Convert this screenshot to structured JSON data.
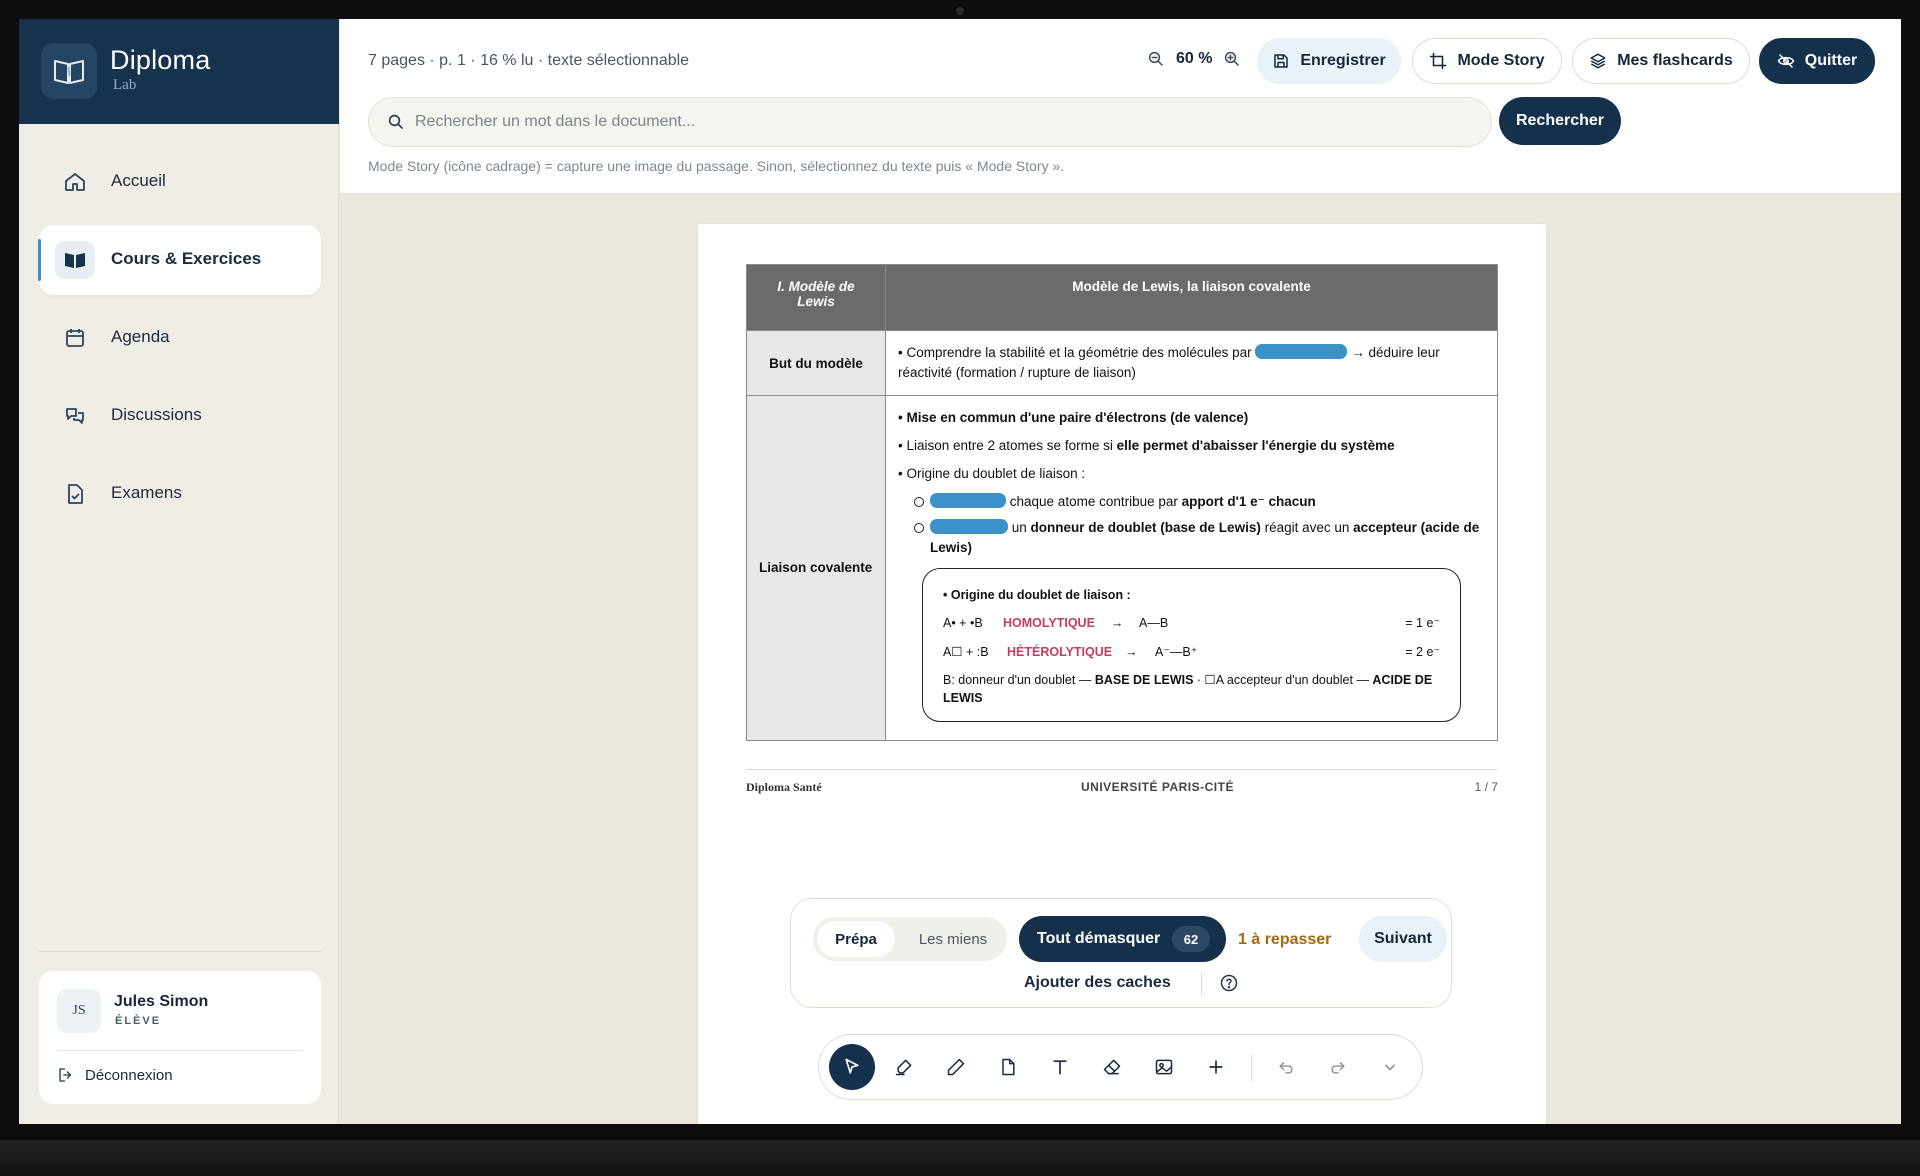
{
  "app": {
    "name": "Diploma",
    "sub": "Lab"
  },
  "nav": [
    {
      "label": "Accueil",
      "icon": "home-icon"
    },
    {
      "label": "Cours & Exercices",
      "icon": "book-icon",
      "active": true
    },
    {
      "label": "Agenda",
      "icon": "calendar-icon"
    },
    {
      "label": "Discussions",
      "icon": "chat-icon"
    },
    {
      "label": "Examens",
      "icon": "exam-file-icon"
    }
  ],
  "user": {
    "initials": "JS",
    "name": "Jules Simon",
    "role": "ÉLÈVE",
    "logout": "Déconnexion"
  },
  "topbar": {
    "meta": "7 pages · p. 1 · 16 % lu · texte sélectionnable",
    "zoom": "60 %",
    "save": "Enregistrer",
    "story": "Mode Story",
    "flashcards": "Mes flashcards",
    "quit": "Quitter",
    "search_placeholder": "Rechercher un mot dans le document...",
    "search_button": "Rechercher",
    "hint": "Mode Story (icône cadrage) = capture une image du passage. Sinon, sélectionnez du texte puis « Mode Story »."
  },
  "doc": {
    "h1": "I. Modèle de Lewis",
    "h2": "Modèle de Lewis, la liaison covalente",
    "goal_label": "But du modèle",
    "goal_a": "• Comprendre la stabilité et la géométrie des molécules par",
    "goal_b": "→ déduire leur réactivité (formation / rupture de liaison)",
    "cov_label": "Liaison covalente",
    "b1": "• Mise en commun d'une paire d'électrons (de valence)",
    "b2a": "• Liaison entre 2 atomes se forme si ",
    "b2b": "elle permet d'abaisser l'énergie du système",
    "b3": "• Origine du doublet de liaison :",
    "s1a": "chaque atome contribue par ",
    "s1b": "apport d'1 e⁻ chacun",
    "s2a": "un ",
    "s2b": "donneur de doublet (base de Lewis)",
    "s2c": " réagit avec un ",
    "s2d": "accepteur (acide de Lewis)",
    "box_title": "• Origine du doublet de liaison :",
    "r1": {
      "eq": "A• + •B",
      "kw": "HOMOLYTIQUE",
      "arrow": "→",
      "res": "A—B",
      "val": "= 1 e⁻"
    },
    "r2": {
      "eq": "A☐ + :B",
      "kw": "HÉTÉROLYTIQUE",
      "arrow": "→",
      "res": "A⁻—B⁺",
      "val": "= 2 e⁻"
    },
    "note_a": "B: donneur d'un doublet — ",
    "note_b": "BASE DE LEWIS",
    "note_c": " · ☐A accepteur d'un doublet — ",
    "note_d": "ACIDE DE LEWIS",
    "footer_left": "Diploma Santé",
    "footer_center": "UNIVERSITÉ PARIS-CITÉ",
    "footer_right": "1 / 7"
  },
  "flash": {
    "seg_on": "Prépa",
    "seg_off": "Les miens",
    "reveal": "Tout démasquer",
    "count": "62",
    "review": "1 à repasser",
    "next": "Suivant",
    "add": "Ajouter des caches"
  },
  "colors": {
    "navy": "#14304a",
    "mask": "#3a92c9",
    "accent": "#3a8fd1",
    "keyword": "#c43e5c"
  }
}
